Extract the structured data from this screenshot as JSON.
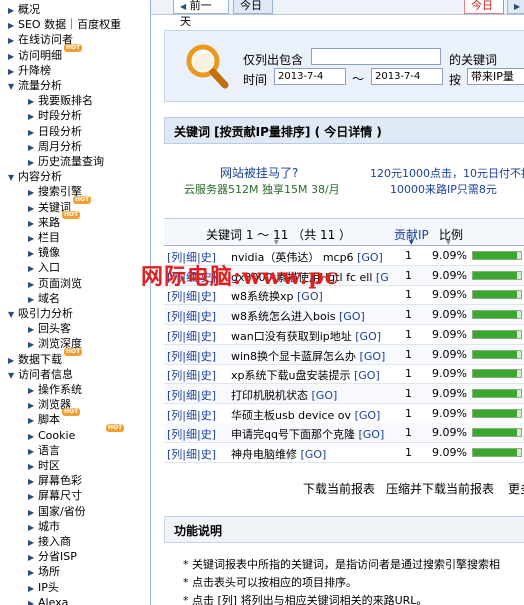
{
  "sidebar": {
    "items": [
      {
        "label": "概况",
        "level": 0,
        "expanded": false,
        "hot": false
      },
      {
        "label": "SEO 数据｜百度权重",
        "level": 0,
        "expanded": false,
        "hot": false
      },
      {
        "label": "在线访问者",
        "level": 0,
        "expanded": false,
        "hot": false
      },
      {
        "label": "访问明细",
        "level": 0,
        "expanded": false,
        "hot": true
      },
      {
        "label": "升降榜",
        "level": 0,
        "expanded": false,
        "hot": false
      },
      {
        "label": "流量分析",
        "level": 0,
        "expanded": true,
        "hot": false
      },
      {
        "label": "我要贩排名",
        "level": 1,
        "expanded": false,
        "hot": false
      },
      {
        "label": "时段分析",
        "level": 1,
        "expanded": false,
        "hot": false
      },
      {
        "label": "日段分析",
        "level": 1,
        "expanded": false,
        "hot": false
      },
      {
        "label": "周月分析",
        "level": 1,
        "expanded": false,
        "hot": false
      },
      {
        "label": "历史流量查询",
        "level": 1,
        "expanded": false,
        "hot": false
      },
      {
        "label": "内容分析",
        "level": 0,
        "expanded": true,
        "hot": false
      },
      {
        "label": "搜索引擎",
        "level": 1,
        "expanded": false,
        "hot": false
      },
      {
        "label": "关键词",
        "level": 1,
        "expanded": false,
        "hot": true
      },
      {
        "label": "来路",
        "level": 1,
        "expanded": false,
        "hot": true
      },
      {
        "label": "栏目",
        "level": 1,
        "expanded": false,
        "hot": false
      },
      {
        "label": "镜像",
        "level": 1,
        "expanded": false,
        "hot": false
      },
      {
        "label": "入口",
        "level": 1,
        "expanded": false,
        "hot": false
      },
      {
        "label": "页面浏览",
        "level": 1,
        "expanded": false,
        "hot": false
      },
      {
        "label": "域名",
        "level": 1,
        "expanded": false,
        "hot": false
      },
      {
        "label": "吸引力分析",
        "level": 0,
        "expanded": true,
        "hot": false
      },
      {
        "label": "回头客",
        "level": 1,
        "expanded": false,
        "hot": false
      },
      {
        "label": "浏览深度",
        "level": 1,
        "expanded": false,
        "hot": false
      },
      {
        "label": "数据下载",
        "level": 0,
        "expanded": false,
        "hot": true
      },
      {
        "label": "访问者信息",
        "level": 0,
        "expanded": true,
        "hot": false
      },
      {
        "label": "操作系统",
        "level": 1,
        "expanded": false,
        "hot": false
      },
      {
        "label": "浏览器",
        "level": 1,
        "expanded": false,
        "hot": false
      },
      {
        "label": "脚本",
        "level": 1,
        "expanded": false,
        "hot": true
      },
      {
        "label": "Cookie",
        "level": 1,
        "expanded": false,
        "hot": true
      },
      {
        "label": "语言",
        "level": 1,
        "expanded": false,
        "hot": false
      },
      {
        "label": "时区",
        "level": 1,
        "expanded": false,
        "hot": false
      },
      {
        "label": "屏幕色彩",
        "level": 1,
        "expanded": false,
        "hot": false
      },
      {
        "label": "屏幕尺寸",
        "level": 1,
        "expanded": false,
        "hot": false
      },
      {
        "label": "国家/省份",
        "level": 1,
        "expanded": false,
        "hot": false
      },
      {
        "label": "城市",
        "level": 1,
        "expanded": false,
        "hot": false
      },
      {
        "label": "接入商",
        "level": 1,
        "expanded": false,
        "hot": false
      },
      {
        "label": "分省ISP",
        "level": 1,
        "expanded": false,
        "hot": false
      },
      {
        "label": "场所",
        "level": 1,
        "expanded": false,
        "hot": false
      },
      {
        "label": "IP头",
        "level": 1,
        "expanded": false,
        "hot": false
      },
      {
        "label": "Alexa",
        "level": 1,
        "expanded": false,
        "hot": false
      }
    ],
    "hot_badge": "HOT"
  },
  "datebar": {
    "prev_label": "前一天",
    "today_label": "今日",
    "today_label_right": "今日"
  },
  "filter": {
    "only_show_label": "仅列出包含",
    "keyword_value": "",
    "keyword_suffix": "的关键词",
    "time_label": "时间",
    "date_from": "2013-7-4",
    "tilde": "～",
    "date_to": "2013-7-4",
    "by_label": "按",
    "sort_select": "带来IP量"
  },
  "section_title": "关键词 [按贡献IP量排序] ( 今日详情 )",
  "ads": {
    "line1_left": "网站被挂马了?",
    "line1_right": "120元1000点击，10元日付不扣里",
    "line2_left": "云服务器512M 独享15M 38/月",
    "line2_right": "10000来路IP只需8元"
  },
  "table": {
    "header_keyword": "关键词 1 ～ 11 （共 11 ）",
    "header_ip": "贡献IP",
    "header_pct": "比例",
    "link_label": "[列|细|史]",
    "go_label": "[GO]",
    "rows": [
      {
        "kw": "nvidia（英伟达） mcp6",
        "ip": "1",
        "pct": "9.09%",
        "share": 0.0909
      },
      {
        "kw": "gx3000 素描使用Hgtl fc ell",
        "ip": "1",
        "pct": "9.09%",
        "share": 0.0909
      },
      {
        "kw": "w8系统换xp",
        "ip": "1",
        "pct": "9.09%",
        "share": 0.0909
      },
      {
        "kw": "w8系统怎么进入bois",
        "ip": "1",
        "pct": "9.09%",
        "share": 0.0909
      },
      {
        "kw": "wan口没有获取到ip地址",
        "ip": "1",
        "pct": "9.09%",
        "share": 0.0909
      },
      {
        "kw": "win8换个显卡蓝屏怎么办",
        "ip": "1",
        "pct": "9.09%",
        "share": 0.0909
      },
      {
        "kw": "xp系统下载u盘安装提示",
        "ip": "1",
        "pct": "9.09%",
        "share": 0.0909
      },
      {
        "kw": "打印机脱机状态",
        "ip": "1",
        "pct": "9.09%",
        "share": 0.0909
      },
      {
        "kw": "华硕主板usb device ov",
        "ip": "1",
        "pct": "9.09%",
        "share": 0.0909
      },
      {
        "kw": "申请完qq号下面那个克隆",
        "ip": "1",
        "pct": "9.09%",
        "share": 0.0909
      },
      {
        "kw": "神舟电脑维修",
        "ip": "1",
        "pct": "9.09%",
        "share": 0.0909
      }
    ]
  },
  "actions": {
    "download": "下载当前报表",
    "zip_download": "压缩并下载当前报表",
    "more": "更多"
  },
  "description": {
    "title": "功能说明",
    "lines": [
      "* 关键词报表中所指的关键词，是指访问者是通过搜索引擎搜索相",
      "* 点击表头可以按相应的项目排序。",
      "* 点击 [列] 将列出与相应关键词相关的来路URL。"
    ]
  },
  "watermark": "网际电脑:www.pc"
}
